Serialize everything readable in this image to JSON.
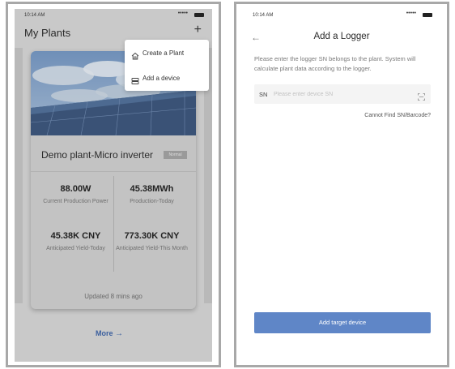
{
  "left": {
    "status": {
      "time": "10:14 AM",
      "signal": "•••••"
    },
    "header": {
      "title": "My Plants",
      "add_symbol": "+"
    },
    "dropdown": [
      {
        "label": "Create a Plant",
        "icon": "home-icon"
      },
      {
        "label": "Add a device",
        "icon": "device-icon"
      }
    ],
    "plant_card": {
      "name": "Demo plant-Micro inverter",
      "tag": "Normal",
      "stats": [
        {
          "value": "88.00W",
          "label": "Current Production Power"
        },
        {
          "value": "45.38MWh",
          "label": "Production-Today"
        },
        {
          "value": "45.38K CNY",
          "label": "Anticipated Yield-Today"
        },
        {
          "value": "773.30K CNY",
          "label": "Anticipated Yield-This Month"
        }
      ],
      "updated": "Updated 8 mins ago"
    },
    "more": {
      "label": "More",
      "arrow": "→"
    }
  },
  "right": {
    "status": {
      "time": "10:14 AM",
      "signal": "•••••"
    },
    "header": {
      "back": "←",
      "title": "Add a Logger"
    },
    "description": "Please enter the logger SN belongs to the plant. System will calculate plant data according to the logger.",
    "sn": {
      "label": "SN",
      "placeholder": "Please enter device SN",
      "value": ""
    },
    "cant_find": "Cannot Find SN/Barcode?",
    "add_button": "Add target device"
  },
  "colors": {
    "accent": "#5f86c7",
    "link": "#3b5f9e",
    "overlay": "#c9c9c9"
  }
}
